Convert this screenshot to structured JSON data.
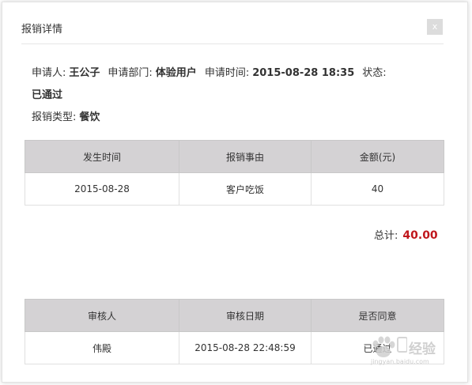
{
  "dialog": {
    "title": "报销详情",
    "close_label": "x"
  },
  "info": {
    "applicant_label": "申请人:",
    "applicant_value": "王公子",
    "department_label": "申请部门:",
    "department_value": "体验用户",
    "time_label": "申请时间:",
    "time_value": "2015-08-28 18:35",
    "status_label": "状态:",
    "status_value": "已通过",
    "type_label": "报销类型:",
    "type_value": "餐饮"
  },
  "expense_table": {
    "headers": [
      "发生时间",
      "报销事由",
      "金额(元)"
    ],
    "rows": [
      [
        "2015-08-28",
        "客户吃饭",
        "40"
      ]
    ]
  },
  "total": {
    "label": "总计:",
    "amount": "40.00"
  },
  "audit_table": {
    "headers": [
      "审核人",
      "审核日期",
      "是否同意"
    ],
    "rows": [
      [
        "伟殿",
        "2015-08-28 22:48:59",
        "已通过"
      ]
    ]
  },
  "watermark": {
    "text": "经验",
    "url": "jingyan.baidu.com"
  },
  "colors": {
    "header_bg": "#d4d2d4",
    "total_amount": "#c0171c",
    "close_bg": "#dcdcdc"
  }
}
